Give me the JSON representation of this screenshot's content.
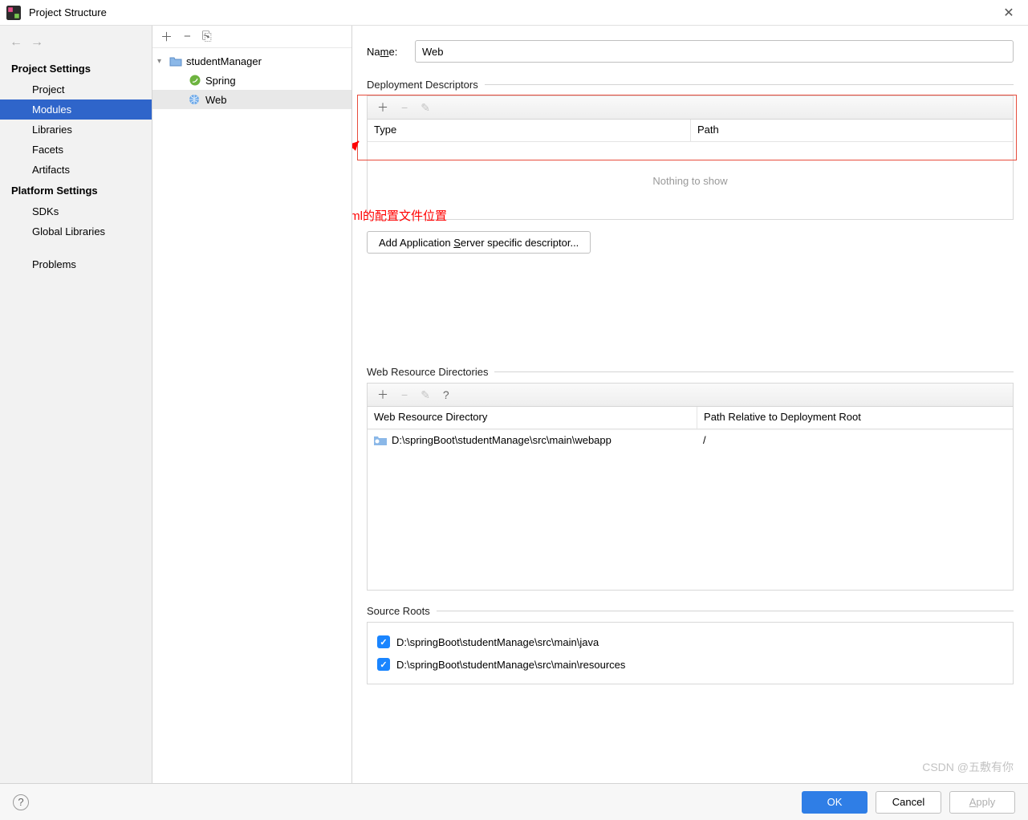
{
  "window": {
    "title": "Project Structure"
  },
  "sidebar": {
    "sections": [
      {
        "heading": "Project Settings",
        "items": [
          "Project",
          "Modules",
          "Libraries",
          "Facets",
          "Artifacts"
        ],
        "selected": 1
      },
      {
        "heading": "Platform Settings",
        "items": [
          "SDKs",
          "Global Libraries"
        ]
      },
      {
        "heading": "",
        "items": [
          "Problems"
        ]
      }
    ]
  },
  "tree": {
    "root": {
      "label": "studentManager",
      "expanded": true
    },
    "children": [
      {
        "label": "Spring",
        "icon": "spring"
      },
      {
        "label": "Web",
        "icon": "web",
        "selected": true
      }
    ]
  },
  "content": {
    "name_label_pre": "Na",
    "name_label_u": "m",
    "name_label_post": "e:",
    "name_value": "Web",
    "dd": {
      "title": "Deployment Descriptors",
      "columns": [
        "Type",
        "Path"
      ],
      "empty": "Nothing to show",
      "button_pre": "Add Application ",
      "button_u": "S",
      "button_post": "erver specific descriptor..."
    },
    "annotation": "添加你的web.xml的配置文件位置",
    "wrd": {
      "title": "Web Resource Directories",
      "columns": [
        "Web Resource Directory",
        "Path Relative to Deployment Root"
      ],
      "rows": [
        {
          "dir": "D:\\springBoot\\studentManage\\src\\main\\webapp",
          "path": "/"
        }
      ]
    },
    "sr": {
      "title": "Source Roots",
      "items": [
        "D:\\springBoot\\studentManage\\src\\main\\java",
        "D:\\springBoot\\studentManage\\src\\main\\resources"
      ]
    }
  },
  "footer": {
    "ok": "OK",
    "cancel": "Cancel",
    "apply_pre": "",
    "apply_u": "A",
    "apply_post": "pply"
  },
  "watermark": "CSDN @五敷有你"
}
